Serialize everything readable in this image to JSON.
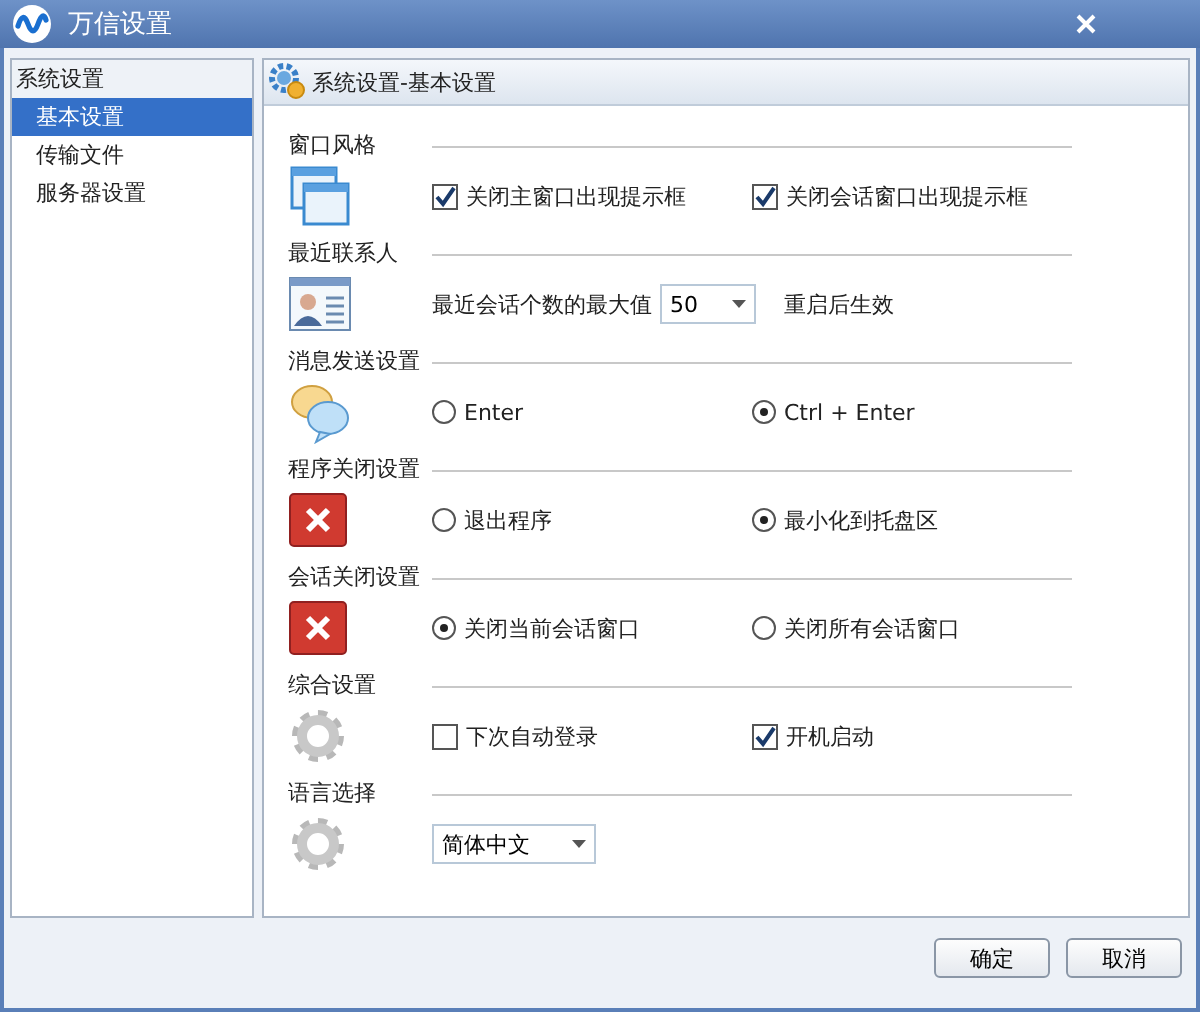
{
  "window": {
    "title": "万信设置"
  },
  "sidebar": {
    "title": "系统设置",
    "items": [
      {
        "label": "基本设置",
        "selected": true
      },
      {
        "label": "传输文件",
        "selected": false
      },
      {
        "label": "服务器设置",
        "selected": false
      }
    ]
  },
  "panel": {
    "title": "系统设置-基本设置"
  },
  "sections": [
    {
      "title": "窗口风格",
      "kind": "checkbox",
      "options": [
        {
          "label": "关闭主窗口出现提示框",
          "checked": true
        },
        {
          "label": "关闭会话窗口出现提示框",
          "checked": true
        }
      ]
    },
    {
      "title": "最近联系人",
      "kind": "dropdown",
      "label": "最近会话个数的最大值",
      "value": "50",
      "note": "重启后生效"
    },
    {
      "title": "消息发送设置",
      "kind": "radio",
      "options": [
        {
          "label": "Enter",
          "selected": false
        },
        {
          "label": "Ctrl + Enter",
          "selected": true
        }
      ]
    },
    {
      "title": "程序关闭设置",
      "kind": "radio",
      "options": [
        {
          "label": "退出程序",
          "selected": false
        },
        {
          "label": "最小化到托盘区",
          "selected": true
        }
      ]
    },
    {
      "title": "会话关闭设置",
      "kind": "radio",
      "options": [
        {
          "label": "关闭当前会话窗口",
          "selected": true
        },
        {
          "label": "关闭所有会话窗口",
          "selected": false
        }
      ]
    },
    {
      "title": "综合设置",
      "kind": "checkbox",
      "options": [
        {
          "label": "下次自动登录",
          "checked": false
        },
        {
          "label": "开机启动",
          "checked": true
        }
      ]
    },
    {
      "title": "语言选择",
      "kind": "dropdown",
      "value": "简体中文"
    }
  ],
  "buttons": [
    "确定",
    "取消"
  ]
}
